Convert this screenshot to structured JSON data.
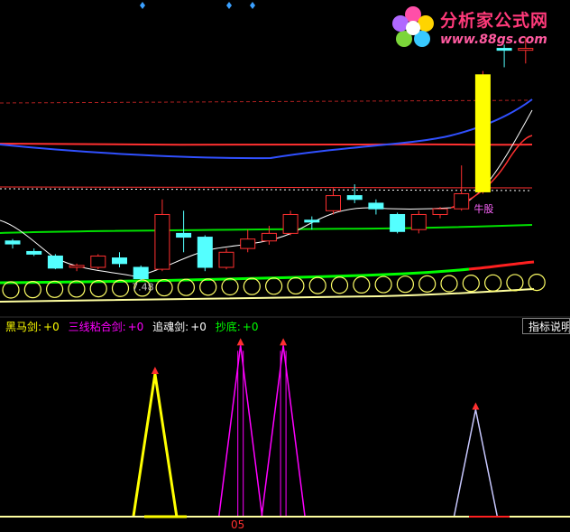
{
  "logo": {
    "title": "分析家公式网",
    "url": "www.88gs.com"
  },
  "price_chart": {
    "candles": [
      {
        "o": 8.7,
        "c": 8.62,
        "h": 8.75,
        "l": 8.5
      },
      {
        "o": 8.42,
        "c": 8.35,
        "h": 8.5,
        "l": 8.3
      },
      {
        "o": 8.3,
        "c": 7.98,
        "h": 8.35,
        "l": 7.95
      },
      {
        "o": 8.0,
        "c": 8.05,
        "h": 8.1,
        "l": 7.9
      },
      {
        "o": 8.0,
        "c": 8.3,
        "h": 8.35,
        "l": 7.95
      },
      {
        "o": 8.25,
        "c": 8.1,
        "h": 8.4,
        "l": 8.0
      },
      {
        "o": 8.0,
        "c": 7.7,
        "h": 8.05,
        "l": 7.65
      },
      {
        "o": 7.95,
        "c": 9.4,
        "h": 9.8,
        "l": 7.9
      },
      {
        "o": 8.9,
        "c": 8.8,
        "h": 9.5,
        "l": 8.4
      },
      {
        "o": 8.8,
        "c": 8.0,
        "h": 8.85,
        "l": 7.9
      },
      {
        "o": 8.0,
        "c": 8.4,
        "h": 8.5,
        "l": 7.95
      },
      {
        "o": 8.5,
        "c": 8.75,
        "h": 9.0,
        "l": 8.4
      },
      {
        "o": 8.7,
        "c": 8.9,
        "h": 9.1,
        "l": 8.6
      },
      {
        "o": 8.9,
        "c": 9.4,
        "h": 9.5,
        "l": 8.85
      },
      {
        "o": 9.25,
        "c": 9.2,
        "h": 9.35,
        "l": 9.0
      },
      {
        "o": 9.5,
        "c": 9.9,
        "h": 10.1,
        "l": 9.4
      },
      {
        "o": 9.9,
        "c": 9.8,
        "h": 10.2,
        "l": 9.7
      },
      {
        "o": 9.7,
        "c": 9.55,
        "h": 9.8,
        "l": 9.4
      },
      {
        "o": 9.4,
        "c": 8.95,
        "h": 9.45,
        "l": 8.9
      },
      {
        "o": 9.0,
        "c": 9.4,
        "h": 9.5,
        "l": 8.9
      },
      {
        "o": 9.4,
        "c": 9.55,
        "h": 9.6,
        "l": 9.3
      },
      {
        "o": 9.55,
        "c": 9.95,
        "h": 10.7,
        "l": 9.5
      },
      {
        "o": 10.0,
        "c": 13.1,
        "h": 13.2,
        "l": 9.95
      },
      {
        "o": 13.8,
        "c": 13.75,
        "h": 13.9,
        "l": 13.3
      },
      {
        "o": 13.75,
        "c": 13.8,
        "h": 14.1,
        "l": 13.4
      }
    ],
    "annotations": [
      {
        "text": "牛股",
        "index": 22,
        "value": 9.55,
        "color": "#ff66ff"
      },
      {
        "text": "7.48",
        "index": 6,
        "value": 7.48,
        "color": "#c0c0c0"
      }
    ]
  },
  "indicator": {
    "legend": [
      {
        "name": "黑马剑:",
        "value": "+0",
        "color": "#ffff00"
      },
      {
        "name": "三线粘合剑:",
        "value": "+0",
        "color": "#ff00ff"
      },
      {
        "name": "追魂剑:",
        "value": "+0",
        "color": "#ffffff"
      },
      {
        "name": "抄底:",
        "value": "+0",
        "color": "#00ff00"
      }
    ],
    "help_label": "指标说明",
    "x_label": "05",
    "signals": [
      {
        "series": "黑马剑",
        "peak_index": 7,
        "value": 1.0,
        "color": "#ffff00"
      },
      {
        "series": "三线粘合剑",
        "peak_index": 11,
        "value": 1.2,
        "color": "#ff00ff"
      },
      {
        "series": "三线粘合剑",
        "peak_index": 13,
        "value": 1.2,
        "color": "#ff00ff"
      },
      {
        "series": "追魂剑",
        "peak_index": 22,
        "value": 0.75,
        "color": "#c8c8ff"
      }
    ]
  }
}
